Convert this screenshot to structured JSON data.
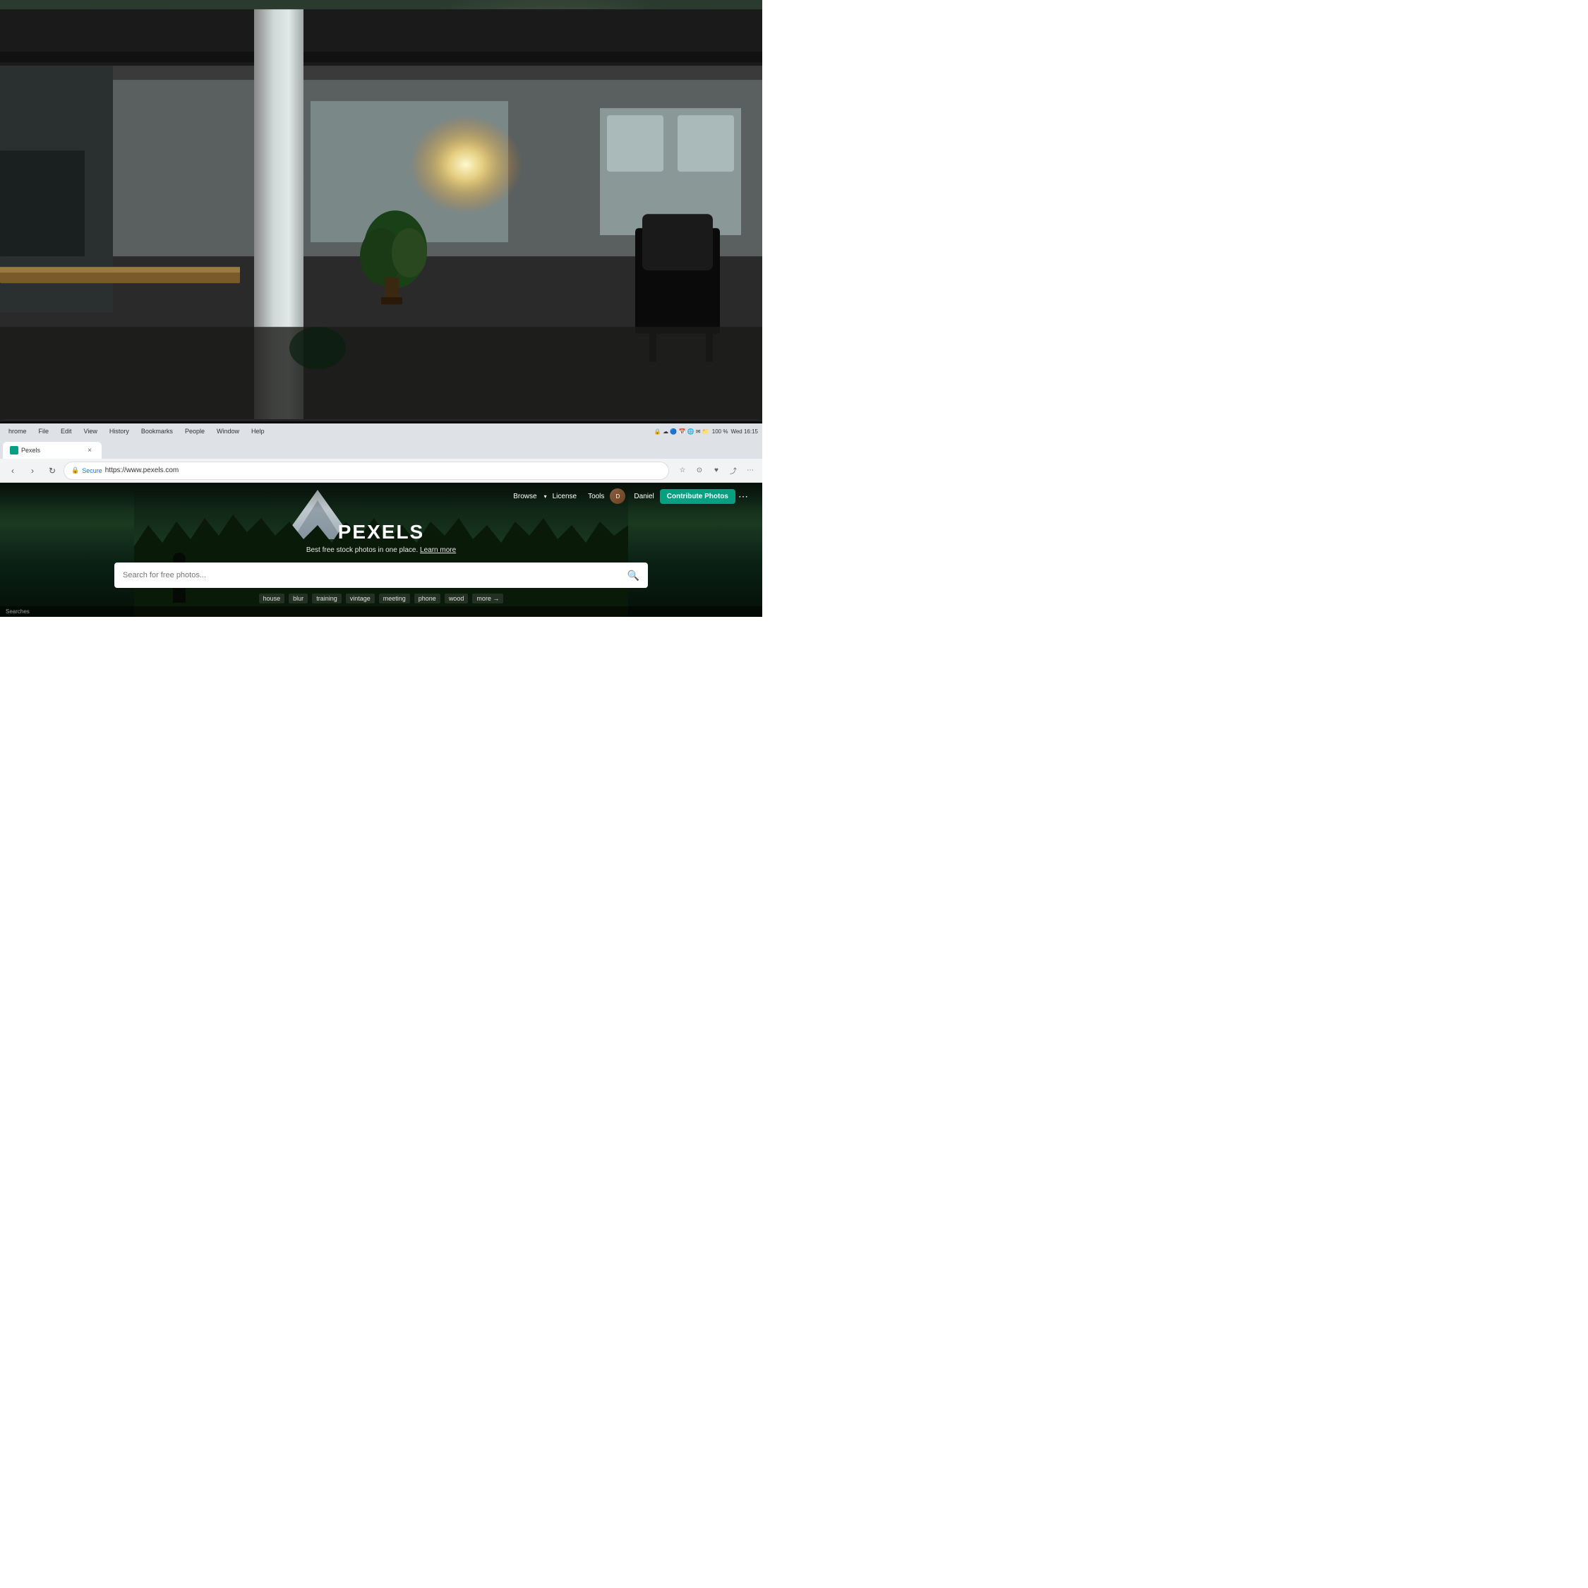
{
  "background": {
    "description": "Office background photo with blurred bokeh"
  },
  "browser": {
    "menu_items": [
      "hrome",
      "File",
      "Edit",
      "View",
      "History",
      "Bookmarks",
      "People",
      "Window",
      "Help"
    ],
    "system_time": "Wed 16:15",
    "battery": "100 %",
    "tab_title": "Pexels",
    "address": "https://www.pexels.com",
    "secure_label": "Secure",
    "address_prefix": "https://www.pexels.com"
  },
  "pexels": {
    "nav": {
      "browse_label": "Browse",
      "license_label": "License",
      "tools_label": "Tools",
      "user_name": "Daniel",
      "contribute_label": "Contribute Photos"
    },
    "hero": {
      "logo": "PEXELS",
      "tagline": "Best free stock photos in one place.",
      "learn_more": "Learn more",
      "search_placeholder": "Search for free photos...",
      "tags": [
        "house",
        "blur",
        "training",
        "vintage",
        "meeting",
        "phone",
        "wood",
        "more →"
      ]
    },
    "footer": {
      "searches_label": "Searches"
    }
  }
}
